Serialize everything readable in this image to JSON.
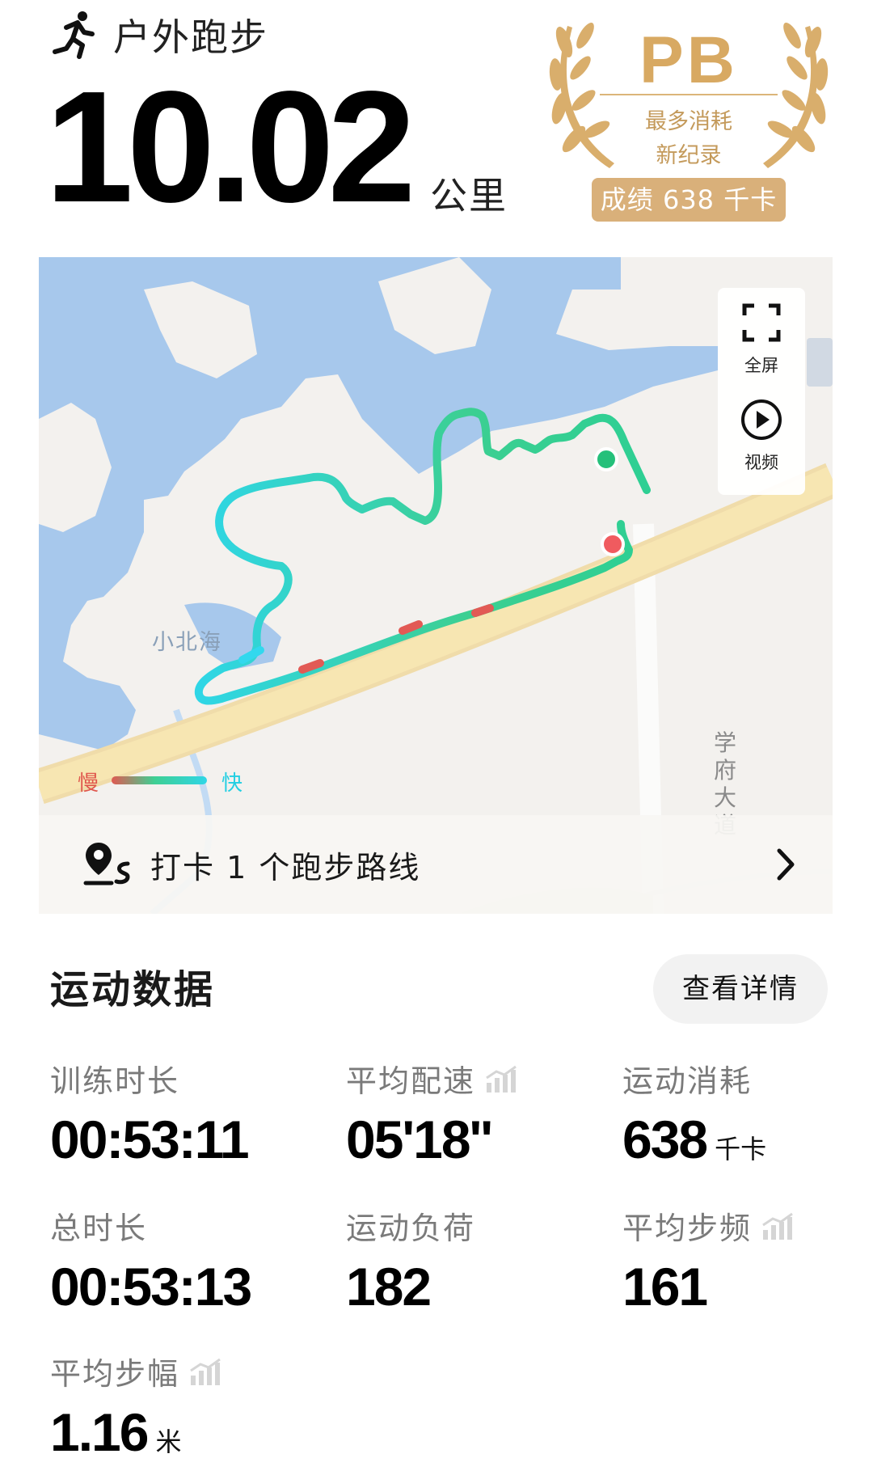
{
  "header": {
    "sport_name": "户外跑步",
    "distance": "10.02",
    "distance_unit": "公里"
  },
  "pb_badge": {
    "title": "PB",
    "line1": "最多消耗",
    "line2": "新纪录",
    "record": "成绩 638 千卡",
    "color": "#d9b07a"
  },
  "map": {
    "controls": {
      "fullscreen": "全屏",
      "video": "视频"
    },
    "lake_label": "小北海",
    "road_label": "学府大道",
    "legend": {
      "slow": "慢",
      "fast": "快"
    },
    "route_color": "#2ecf93",
    "start_color": "#25c07a",
    "end_color": "#f05b5f",
    "checkin": "打卡 1 个跑步路线"
  },
  "stats": {
    "section_title": "运动数据",
    "detail_button": "查看详情",
    "items": [
      {
        "label": "训练时长",
        "value": "00:53:11",
        "unit": ""
      },
      {
        "label": "平均配速",
        "value": "05'18''",
        "unit": ""
      },
      {
        "label": "运动消耗",
        "value": "638",
        "unit": "千卡"
      },
      {
        "label": "总时长",
        "value": "00:53:13",
        "unit": ""
      },
      {
        "label": "运动负荷",
        "value": "182",
        "unit": ""
      },
      {
        "label": "平均步频",
        "value": "161",
        "unit": ""
      },
      {
        "label": "平均步幅",
        "value": "1.16",
        "unit": "米"
      }
    ]
  }
}
